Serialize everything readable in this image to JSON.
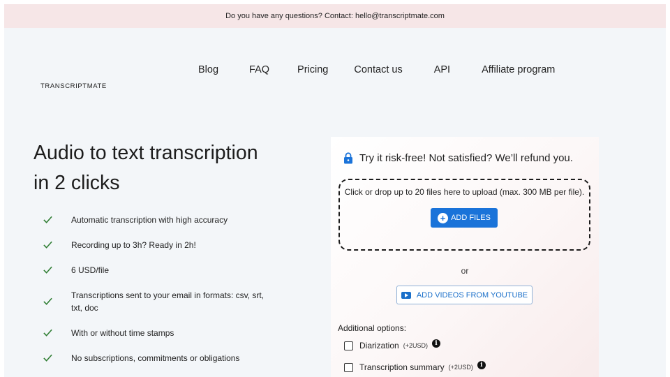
{
  "topbar": {
    "text": "Do you have any questions? Contact: hello@transcriptmate.com"
  },
  "logo": {
    "text": "TRANSCRIPTMATE",
    "icon": "sound-wave-icon"
  },
  "nav": {
    "items": [
      {
        "label": "Blog"
      },
      {
        "label": "FAQ"
      },
      {
        "label": "Pricing"
      },
      {
        "label": "Contact us"
      },
      {
        "label": "API"
      },
      {
        "label": "Affiliate program"
      }
    ]
  },
  "hero": {
    "title_line1": "Audio to text transcription",
    "title_line2": "in 2 clicks",
    "features": [
      {
        "text": "Automatic transcription with high accuracy"
      },
      {
        "text": "Recording up to 3h? Ready in 2h!"
      },
      {
        "text": "6 USD/file"
      },
      {
        "text": "Transcriptions sent to your email in formats: csv, srt, txt, doc"
      },
      {
        "text": "With or without time stamps"
      },
      {
        "text": "No subscriptions, commitments or obligations"
      }
    ]
  },
  "upload": {
    "guarantee": "Try it risk-free! Not satisfied? We’ll refund you.",
    "drop_text": "Click or drop up to 20 files here to upload (max. 300 MB per file).",
    "add_files_label": "ADD FILES",
    "or_text": "or",
    "youtube_label": "ADD VIDEOS FROM YOUTUBE",
    "additional_label": "Additional options:",
    "options": [
      {
        "label": "Diarization",
        "price": "(+2USD)",
        "checked": false
      },
      {
        "label": "Transcription summary",
        "price": "(+2USD)",
        "checked": false
      }
    ]
  },
  "colors": {
    "accent": "#1a73d9",
    "check": "#2e7d32",
    "topbar_bg": "#f6e6e7",
    "page_bg": "#f3f6f9"
  }
}
